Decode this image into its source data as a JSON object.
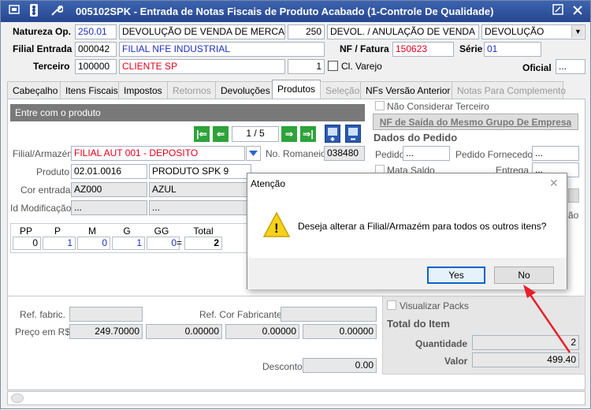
{
  "titlebar": {
    "title": "005102SPK - Entrada de Notas Fiscais de Produto Acabado (1-Controle De Qualidade)",
    "icon_traffic": "⦿",
    "icon_tool": "🔧",
    "icon_edit": "✎",
    "icon_close": "✕"
  },
  "header": {
    "natureza_label": "Natureza Op.",
    "natureza_code": "250.01",
    "natureza_desc": "DEVOLUÇÃO DE VENDA DE MERCADORIA",
    "natureza_num": "250",
    "natureza_type": "DEVOL. / ANULAÇÃO DE VENDA",
    "natureza_select": "DEVOLUÇÃO",
    "filial_label": "Filial Entrada",
    "filial_code": "000042",
    "filial_name": "FILIAL NFE INDUSTRIAL",
    "nf_label": "NF / Fatura",
    "nf_value": "150623",
    "serie_label": "Série",
    "serie_value": "01",
    "terceiro_label": "Terceiro",
    "terceiro_code": "100000",
    "terceiro_name": "CLIENTE SP",
    "terceiro_num": "1",
    "varejo_label": "Cl. Varejo",
    "oficial_label": "Oficial",
    "oficial_value": "..."
  },
  "tabs": [
    {
      "label": "Cabeçalho",
      "state": "normal"
    },
    {
      "label": "Itens Fiscais",
      "state": "normal"
    },
    {
      "label": "Impostos",
      "state": "normal"
    },
    {
      "label": "Retornos",
      "state": "disabled"
    },
    {
      "label": "Devoluções",
      "state": "normal"
    },
    {
      "label": "Produtos",
      "state": "active"
    },
    {
      "label": "Seleção",
      "state": "disabled"
    },
    {
      "label": "NFs Versão Anterior",
      "state": "normal"
    },
    {
      "label": "Notas Para Complemento",
      "state": "disabled"
    }
  ],
  "produto": {
    "section_title": "Entre com o produto",
    "pager": "1 / 5",
    "filial_label": "Filial/Armazém",
    "filial_value": "FILIAL AUT 001 - DEPOSITO",
    "romaneio_label": "No. Romaneio",
    "romaneio_value": "038480",
    "produto_label": "Produto",
    "produto_code": "02.01.0016",
    "produto_name": "PRODUTO SPK 9",
    "cor_label": "Cor entrada",
    "cor_code": "AZ000",
    "cor_name": "AZUL",
    "idmod_label": "Id Modificação",
    "idmod_code": "...",
    "idmod_name": "...",
    "nao_considerar_label": "Não Considerar Terceiro",
    "nf_saida_button": "NF de Saída do Mesmo Grupo De Empresa",
    "dados_pedido_title": "Dados do Pedido",
    "pedido_label": "Pedido",
    "pedido_value": "...",
    "pedido_fornecedor_label": "Pedido Fornecedor",
    "pedido_fornecedor_value": "...",
    "mata_saldo_label": "Mata Saldo",
    "entrega_label": "Entrega",
    "entrega_value": "...",
    "partial_text": "ão"
  },
  "grade": {
    "headers": [
      "PP",
      "P",
      "M",
      "G",
      "GG",
      "Total"
    ],
    "values": [
      "0",
      "1",
      "0",
      "1",
      "0"
    ],
    "equals": "=",
    "total": "2"
  },
  "precos": {
    "ref_fabric_label": "Ref. fabric.",
    "ref_cor_label": "Ref. Cor Fabricante",
    "preco_label": "Preço em R$",
    "preco_values": [
      "249.70000",
      "0.00000",
      "0.00000",
      "0.00000"
    ],
    "desconto_label": "Desconto",
    "desconto_value": "0.00"
  },
  "total_item": {
    "visualizar_packs_label": "Visualizar Packs",
    "title": "Total do Item",
    "quantidade_label": "Quantidade",
    "quantidade_value": "2",
    "valor_label": "Valor",
    "valor_value": "499.40"
  },
  "dialog": {
    "title": "Atenção",
    "message": "Deseja alterar a Filial/Armazém para todos os outros itens?",
    "yes_label": "Yes",
    "no_label": "No",
    "warning_glyph": "!",
    "close_glyph": "✕"
  },
  "colors": {
    "titlebar": "#2e4f9c",
    "arrow": "#e8202a",
    "nav_green": "#2ea33a"
  }
}
